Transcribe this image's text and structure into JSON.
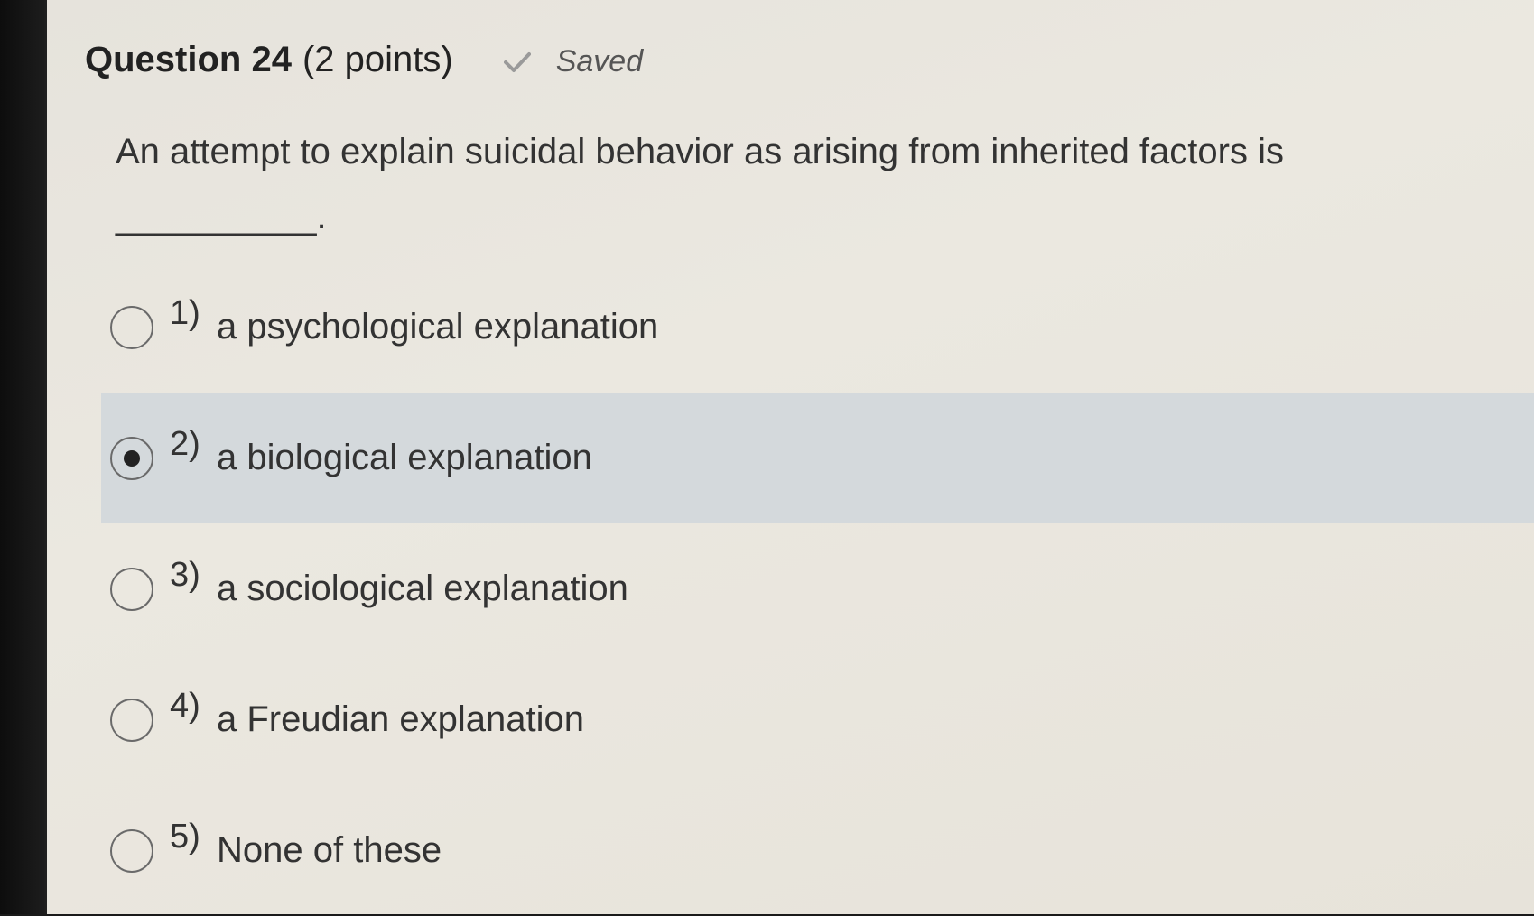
{
  "question": {
    "title": "Question 24",
    "points": "(2 points)",
    "status": "Saved",
    "prompt": "An attempt to explain suicidal behavior as arising from inherited factors is",
    "blank": "__________."
  },
  "options": [
    {
      "num": "1)",
      "text": "a psychological explanation",
      "selected": false
    },
    {
      "num": "2)",
      "text": "a biological explanation",
      "selected": true
    },
    {
      "num": "3)",
      "text": "a sociological explanation",
      "selected": false
    },
    {
      "num": "4)",
      "text": "a Freudian explanation",
      "selected": false
    },
    {
      "num": "5)",
      "text": "None of these",
      "selected": false
    }
  ],
  "colors": {
    "selected_row": "#d4d9dc",
    "background": "#e9e6de"
  }
}
